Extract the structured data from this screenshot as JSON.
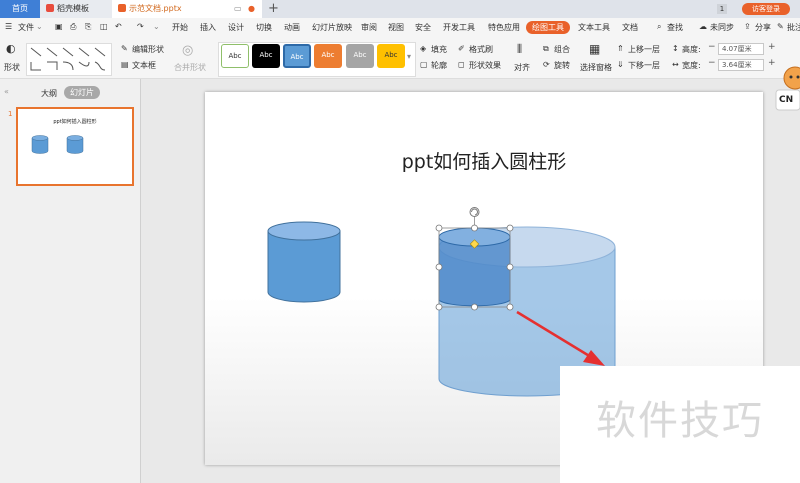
{
  "titlebar": {
    "tabs": [
      "首页",
      "稻壳模板",
      "示范文档.pptx"
    ],
    "badge": "1",
    "login": "访客登录"
  },
  "menubar": {
    "file": "文件",
    "items": [
      "开始",
      "插入",
      "设计",
      "切换",
      "动画",
      "幻灯片放映",
      "审阅",
      "视图",
      "安全",
      "开发工具",
      "特色应用",
      "绘图工具",
      "文本工具",
      "文档"
    ],
    "active": "绘图工具",
    "search": "查找",
    "sync": "未同步",
    "share": "分享",
    "annotate": "批注"
  },
  "ribbon": {
    "shape": "形状",
    "edit_shape": "编辑形状",
    "text_box": "文本框",
    "merge_shape": "合并形状",
    "style_label": "Abc",
    "style_colors": [
      "#ffffff",
      "#000000",
      "#5b9bd5",
      "#ed7d31",
      "#a5a5a5",
      "#ffc000"
    ],
    "fill": "填充",
    "format_brush": "格式刷",
    "outline": "轮廓",
    "shape_effect": "形状效果",
    "align": "对齐",
    "group": "组合",
    "rotate": "旋转",
    "selection_pane": "选择窗格",
    "bring_forward": "上移一层",
    "send_backward": "下移一层",
    "height_label": "高度:",
    "height_value": "4.07厘米",
    "width_label": "宽度:",
    "width_value": "3.64厘米"
  },
  "panel": {
    "tab_outline": "大纲",
    "tab_slides": "幻灯片",
    "slide_number": "1",
    "thumb_title": "ppt如何插入圆柱形"
  },
  "slide": {
    "title": "ppt如何插入圆柱形"
  },
  "badge_cn": "CN",
  "watermark": "软件技巧"
}
